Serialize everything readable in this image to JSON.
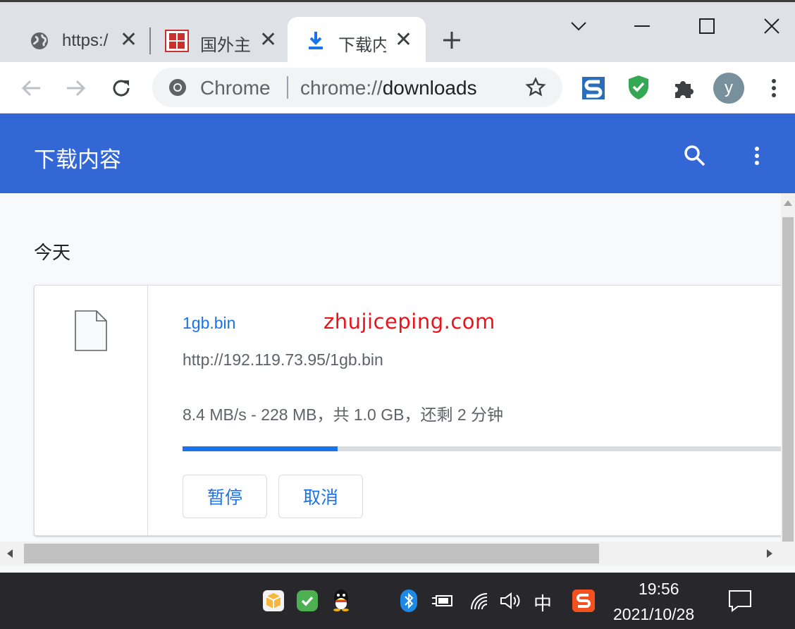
{
  "tabs": [
    {
      "title": "https:/",
      "icon": "globe-icon"
    },
    {
      "title": "国外主",
      "icon": "site-favicon"
    },
    {
      "title": "下载内",
      "icon": "download-icon",
      "active": true
    }
  ],
  "window_controls": [
    "chevron-down-icon",
    "minimize-icon",
    "maximize-icon",
    "close-icon"
  ],
  "omnibox": {
    "scheme_label": "Chrome",
    "url_prefix": "chrome://",
    "url_host": "downloads"
  },
  "profile": {
    "avatar_letter": "y"
  },
  "page": {
    "title": "下载内容",
    "date_group": "今天"
  },
  "download": {
    "file_name": "1gb.bin",
    "watermark": "zhujiceping.com",
    "url": "http://192.119.73.95/1gb.bin",
    "status": "8.4 MB/s - 228 MB，共 1.0 GB，还剩 2 分钟",
    "progress_fraction": 0.25,
    "pause_label": "暂停",
    "cancel_label": "取消"
  },
  "taskbar": {
    "ime": "中",
    "time": "19:56",
    "date": "2021/10/28"
  },
  "colors": {
    "header": "#3367d6",
    "accent": "#1a73e8",
    "watermark": "#e8141c",
    "taskbar": "#28282c"
  }
}
